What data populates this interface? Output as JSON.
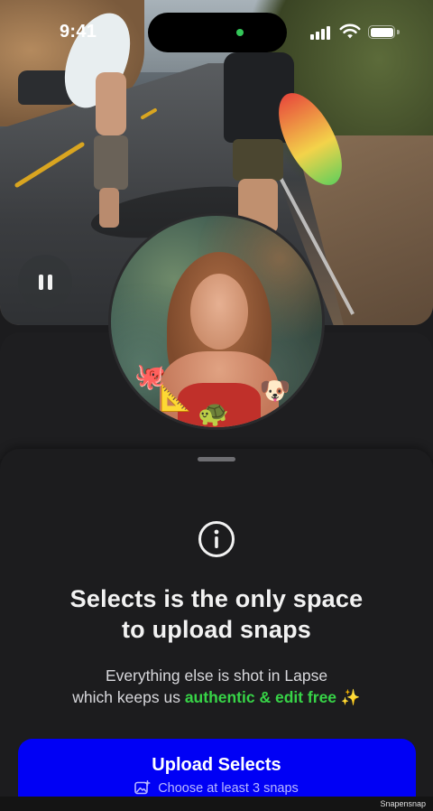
{
  "status_bar": {
    "time": "9:41"
  },
  "video": {
    "pause_icon": "pause-icon"
  },
  "selfie": {
    "emojis": [
      "🐙",
      "📐",
      "🐢",
      "🐶"
    ]
  },
  "sheet": {
    "info_icon": "info-circle-icon",
    "headline_line1": "Selects is the only space",
    "headline_line2": "to upload snaps",
    "body_line1": "Everything else is shot in Lapse",
    "body_line2_prefix": "which keeps us ",
    "body_line2_highlight": "authentic & edit free",
    "body_line2_suffix": " ✨",
    "highlight_color": "#37d447"
  },
  "upload_button": {
    "title": "Upload Selects",
    "subtitle": "Choose at least 3 snaps",
    "color": "#0000f5",
    "icon": "photo-add-icon"
  },
  "watermark": "Snapensnap"
}
